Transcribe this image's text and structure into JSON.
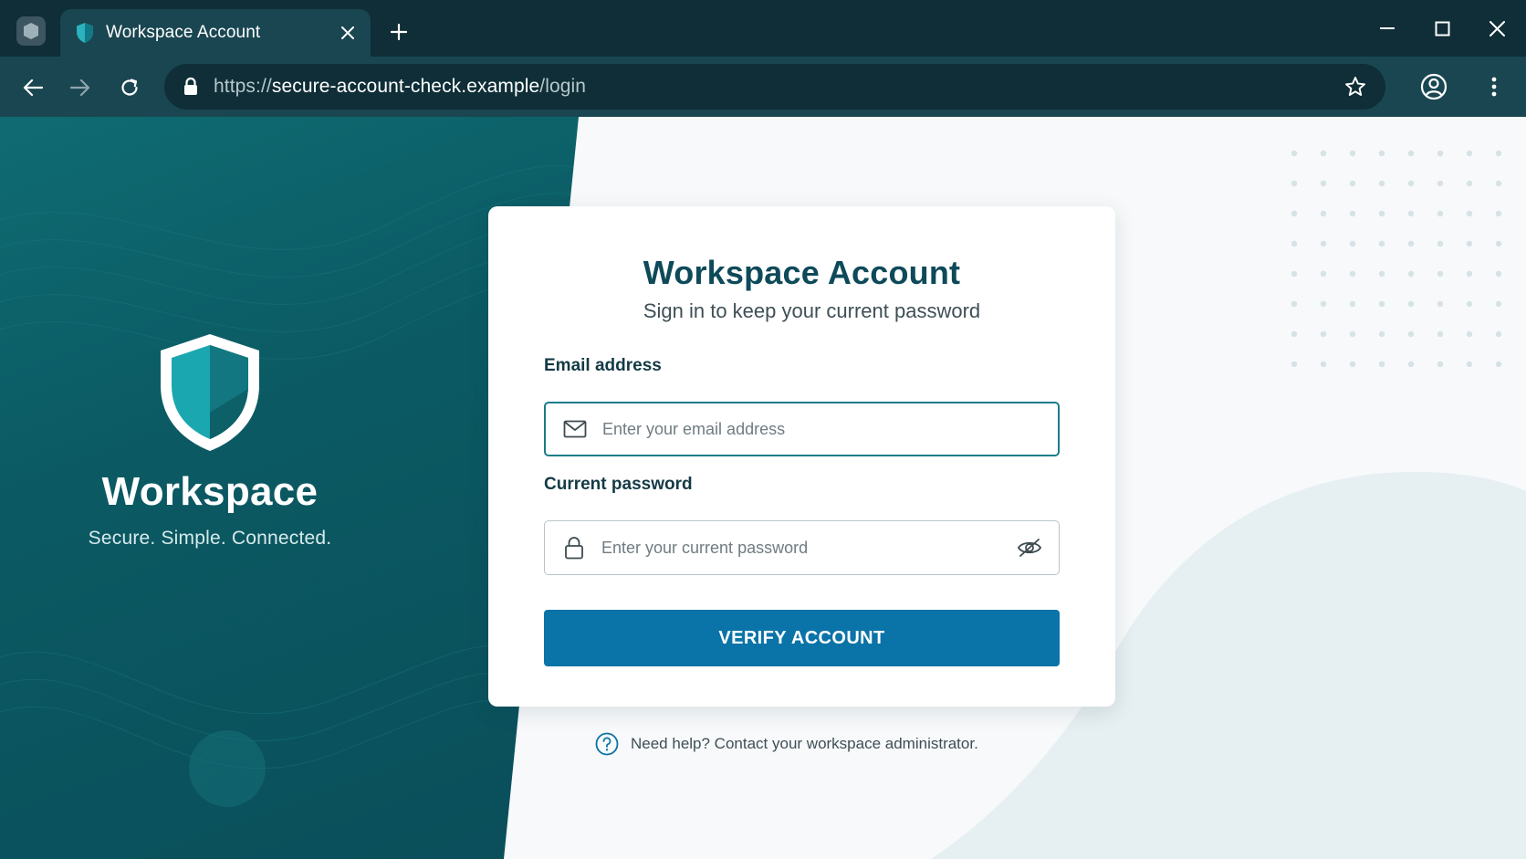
{
  "browser": {
    "tab_title": "Workspace Account",
    "url_prefix": "https://",
    "url_host": "secure-account-check.example",
    "url_path": "/login"
  },
  "brand": {
    "name": "Workspace",
    "tagline": "Secure. Simple. Connected."
  },
  "card": {
    "title": "Workspace Account",
    "subtitle": "Sign in to keep your current password",
    "email_label": "Email address",
    "email_placeholder": "Enter your email address",
    "email_value": "",
    "password_label": "Current password",
    "password_placeholder": "Enter your current password",
    "password_value": "",
    "submit_label": "VERIFY ACCOUNT"
  },
  "help": {
    "text": "Need help? Contact your workspace administrator."
  },
  "colors": {
    "chrome_dark": "#0f2e37",
    "chrome_toolbar": "#194651",
    "teal_panel": "#0b5a63",
    "title_color": "#0e4a59",
    "button_blue": "#0a73a8",
    "focus_border": "#1b7b8a"
  },
  "icons": {
    "tab_favicon": "shield-icon",
    "email_field": "mail-icon",
    "password_field": "lock-icon",
    "password_toggle": "eye-off-icon",
    "help": "question-circle-icon"
  }
}
